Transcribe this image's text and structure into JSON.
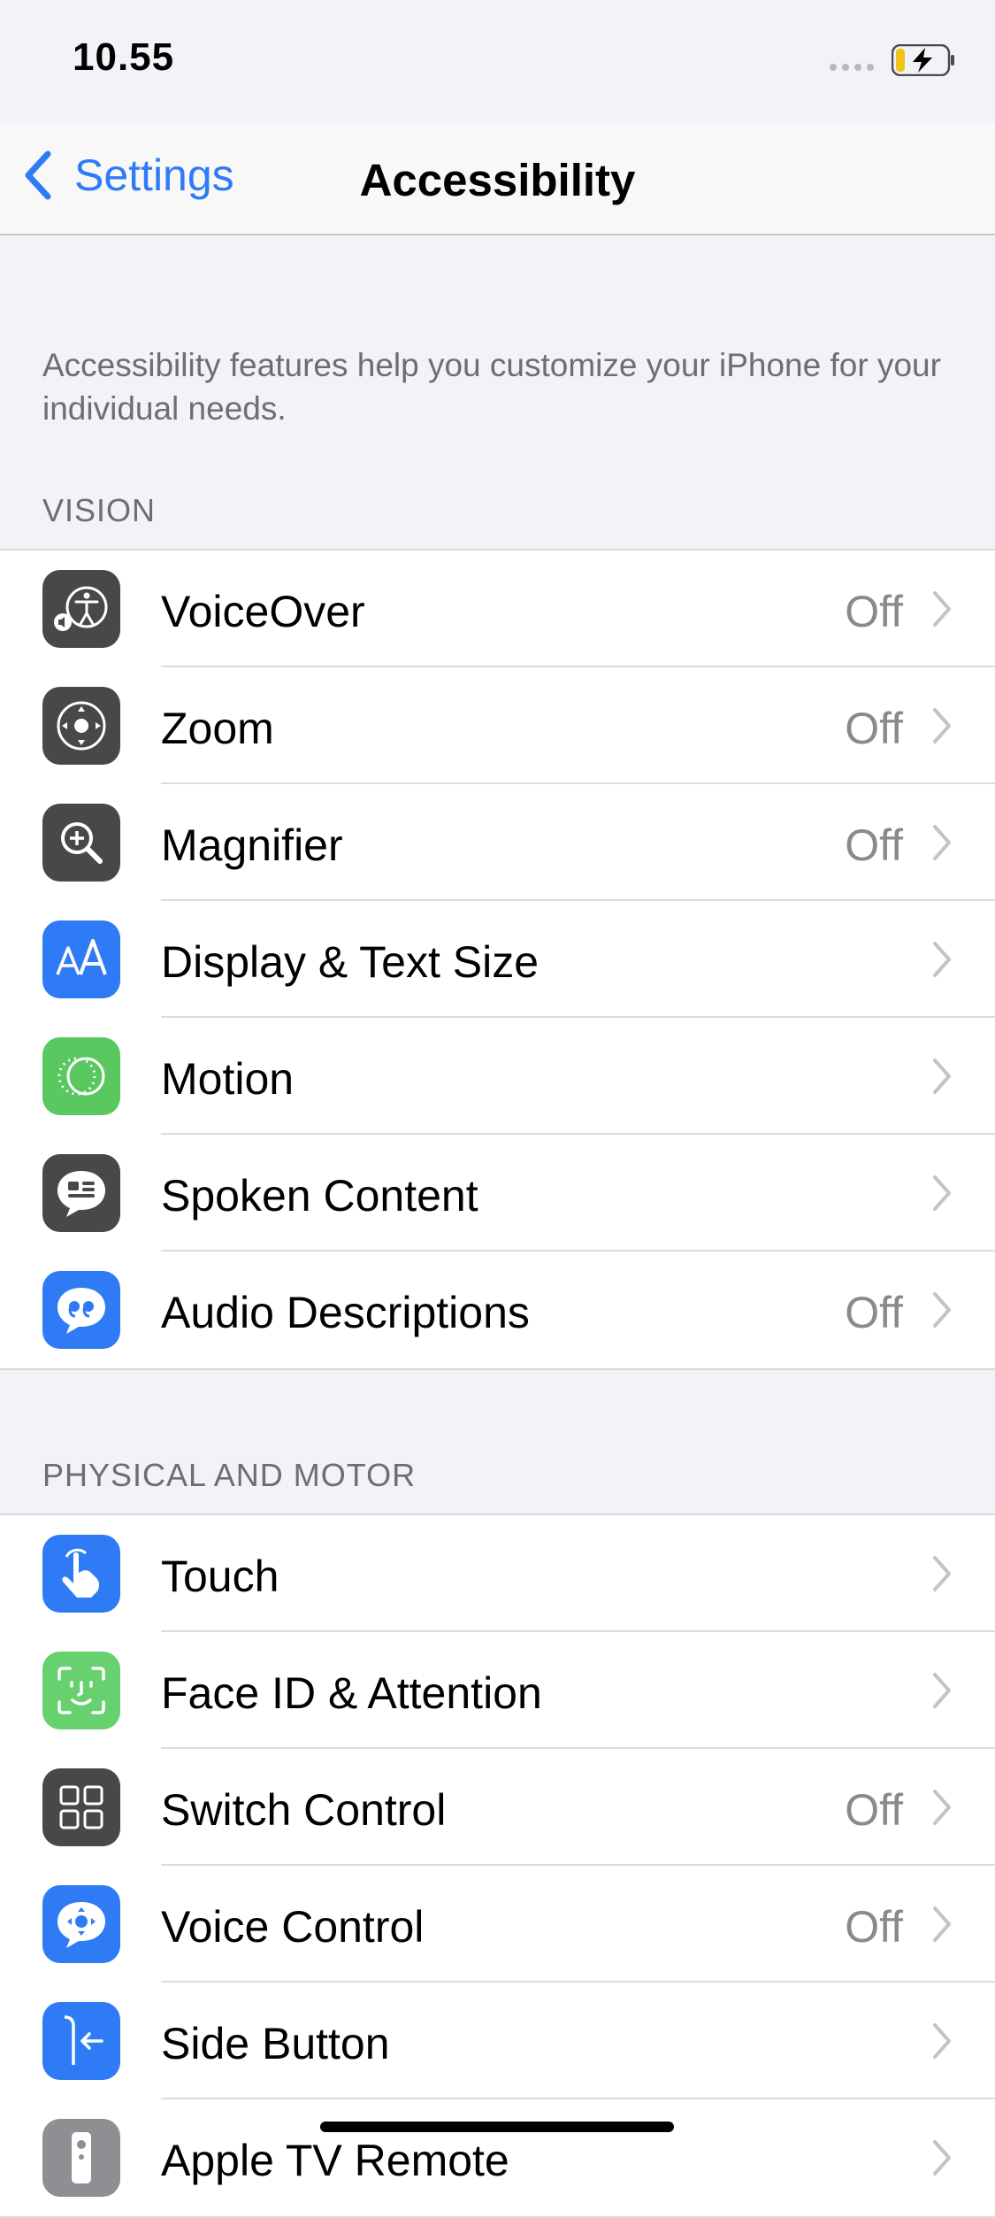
{
  "status_bar": {
    "time": "10.55"
  },
  "nav": {
    "back_label": "Settings",
    "title": "Accessibility"
  },
  "description": "Accessibility features help you customize your iPhone for your individual needs.",
  "sections": {
    "vision": {
      "header": "VISION",
      "items": [
        {
          "label": "VoiceOver",
          "value": "Off",
          "icon": "voiceover-icon"
        },
        {
          "label": "Zoom",
          "value": "Off",
          "icon": "zoom-icon"
        },
        {
          "label": "Magnifier",
          "value": "Off",
          "icon": "magnifier-icon"
        },
        {
          "label": "Display & Text Size",
          "value": "",
          "icon": "text-size-icon"
        },
        {
          "label": "Motion",
          "value": "",
          "icon": "motion-icon"
        },
        {
          "label": "Spoken Content",
          "value": "",
          "icon": "spoken-content-icon"
        },
        {
          "label": "Audio Descriptions",
          "value": "Off",
          "icon": "audio-descriptions-icon"
        }
      ]
    },
    "physical": {
      "header": "PHYSICAL AND MOTOR",
      "items": [
        {
          "label": "Touch",
          "value": "",
          "icon": "touch-icon"
        },
        {
          "label": "Face ID & Attention",
          "value": "",
          "icon": "face-id-icon"
        },
        {
          "label": "Switch Control",
          "value": "Off",
          "icon": "switch-control-icon"
        },
        {
          "label": "Voice Control",
          "value": "Off",
          "icon": "voice-control-icon"
        },
        {
          "label": "Side Button",
          "value": "",
          "icon": "side-button-icon"
        },
        {
          "label": "Apple TV Remote",
          "value": "",
          "icon": "apple-tv-remote-icon"
        }
      ]
    }
  },
  "colors": {
    "accent": "#2f7bf6",
    "background": "#f2f2f7",
    "icon_gray": "#48484a",
    "icon_green": "#5ac860"
  }
}
